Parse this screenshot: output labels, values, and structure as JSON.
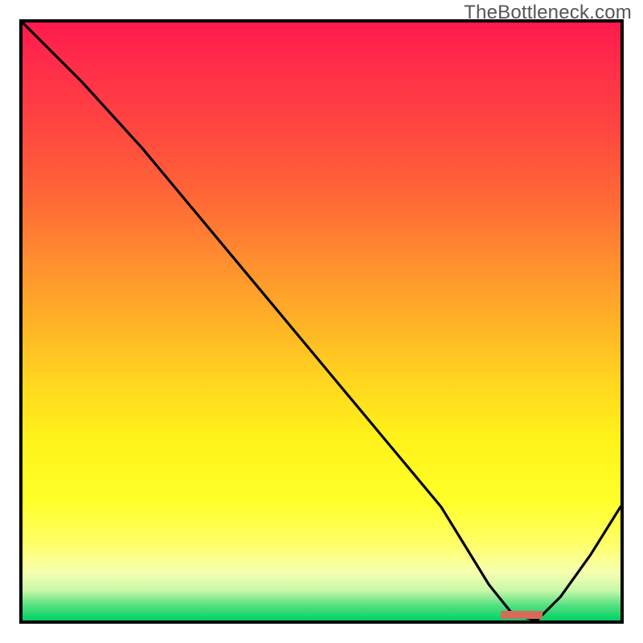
{
  "watermark": "TheBottleneck.com",
  "colors": {
    "border": "#000000",
    "curve": "#000000",
    "tick": "#d66b5a",
    "gradient_top": "#ff1a4d",
    "gradient_mid": "#ffe81a",
    "gradient_bottom": "#00d166"
  },
  "chart_data": {
    "type": "line",
    "title": "",
    "xlabel": "",
    "ylabel": "",
    "xlim": [
      0,
      100
    ],
    "ylim": [
      0,
      100
    ],
    "grid": false,
    "legend": false,
    "series": [
      {
        "name": "curve",
        "x": [
          0,
          10,
          20,
          25,
          30,
          40,
          50,
          60,
          70,
          78,
          82,
          86,
          90,
          95,
          100
        ],
        "y": [
          100,
          90,
          79,
          73,
          67,
          55,
          43,
          31,
          19,
          6,
          1,
          0,
          4,
          11,
          19
        ]
      }
    ],
    "marker": {
      "x_start": 80,
      "x_end": 87,
      "y": 1
    },
    "notes": "x and y are 0–100 relative units; y=100 is top of plot, y=0 is bottom. Values estimated from pixel positions in source image; no axis labels or numeric ticks are rendered in the original, so scale is nominal."
  }
}
